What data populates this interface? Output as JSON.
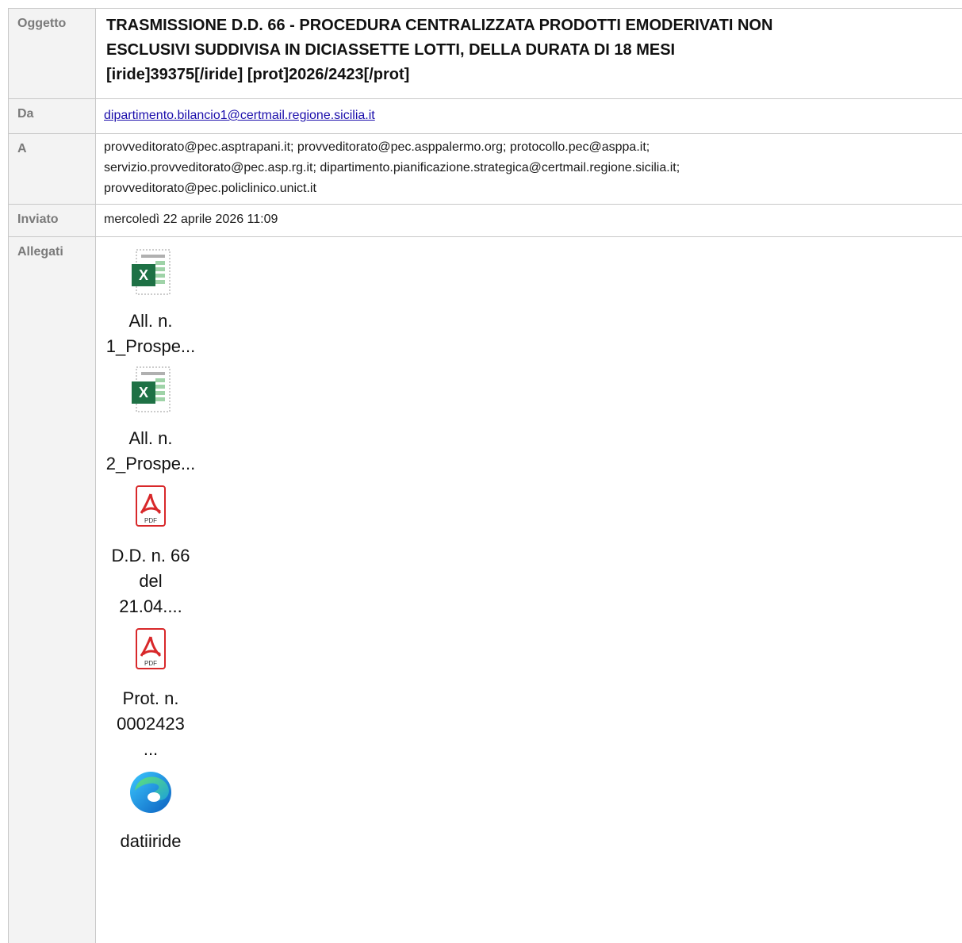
{
  "fields": {
    "subject_label": "Oggetto",
    "subject_line1": "TRASMISSIONE D.D. 66 - PROCEDURA CENTRALIZZATA PRODOTTI EMODERIVATI NON",
    "subject_line2": "ESCLUSIVI SUDDIVISA IN DICIASSETTE LOTTI, DELLA DURATA DI 18 MESI",
    "subject_line3": "[iride]39375[/iride] [prot]2026/2423[/prot]",
    "from_label": "Da",
    "from_value": "dipartimento.bilancio1@certmail.regione.sicilia.it",
    "to_label": "A",
    "to_line1": "provveditorato@pec.asptrapani.it; provveditorato@pec.asppalermo.org; protocollo.pec@asppa.it;",
    "to_line2": "servizio.provveditorato@pec.asp.rg.it; dipartimento.pianificazione.strategica@certmail.regione.sicilia.it;",
    "to_line3": "provveditorato@pec.policlinico.unict.it",
    "sent_label": "Inviato",
    "sent_value": "mercoledì 22 aprile 2026 11:09",
    "attachments_label": "Allegati"
  },
  "attachments": [
    {
      "icon": "excel-file-icon",
      "line1": "All. n.",
      "line2": "1_Prospe..."
    },
    {
      "icon": "excel-file-icon",
      "line1": "All. n.",
      "line2": "2_Prospe..."
    },
    {
      "icon": "pdf-file-icon",
      "line1": "D.D. n. 66",
      "line2": "del 21.04...."
    },
    {
      "icon": "pdf-file-icon",
      "line1": "Prot. n.",
      "line2": "0002423 ..."
    },
    {
      "icon": "edge-browser-icon",
      "line1": "datiiride",
      "line2": ""
    }
  ],
  "colors": {
    "label_bg": "#f3f3f3",
    "label_text": "#7a7a7a",
    "link": "#1a0dab",
    "border": "#c8c8c8"
  }
}
